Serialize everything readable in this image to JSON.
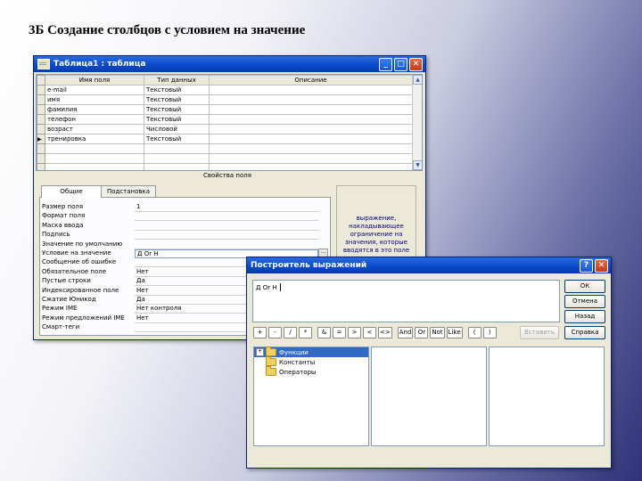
{
  "slide_title": "3Б Создание столбцов с условием на значение",
  "table_window": {
    "title": "Таблица1 : таблица",
    "columns": [
      "Имя поля",
      "Тип данных",
      "Описание"
    ],
    "rows": [
      {
        "name": "e-mail",
        "type": "Текстовый"
      },
      {
        "name": "имя",
        "type": "Текстовый"
      },
      {
        "name": "фамилия",
        "type": "Текстовый"
      },
      {
        "name": "телефон",
        "type": "Текстовый"
      },
      {
        "name": "возраст",
        "type": "Числовой"
      },
      {
        "name": "тренировка",
        "type": "Текстовый"
      }
    ],
    "props_caption": "Свойства поля",
    "tabs": [
      "Общие",
      "Подстановка"
    ],
    "properties": [
      {
        "label": "Размер поля",
        "value": "1"
      },
      {
        "label": "Формат поля",
        "value": ""
      },
      {
        "label": "Маска ввода",
        "value": ""
      },
      {
        "label": "Подпись",
        "value": ""
      },
      {
        "label": "Значение по умолчанию",
        "value": ""
      },
      {
        "label": "Условие на значение",
        "value": "Д Or Н"
      },
      {
        "label": "Сообщение об ошибке",
        "value": ""
      },
      {
        "label": "Обязательное поле",
        "value": "Нет"
      },
      {
        "label": "Пустые строки",
        "value": "Да"
      },
      {
        "label": "Индексированное поле",
        "value": "Нет"
      },
      {
        "label": "Сжатие Юникод",
        "value": "Да"
      },
      {
        "label": "Режим IME",
        "value": "Нет контроля"
      },
      {
        "label": "Режим предложений IME",
        "value": "Нет"
      },
      {
        "label": "Смарт-теги",
        "value": ""
      }
    ],
    "help_text": "выражение, накладывающее ограничение на значения, которые вводятся в это поле"
  },
  "builder_window": {
    "title": "Построитель выражений",
    "expression": "Д Or Н",
    "buttons": {
      "ok": "ОК",
      "cancel": "Отмена",
      "back": "Назад",
      "insert": "Вставить",
      "help": "Справка"
    },
    "operators": [
      "+",
      "-",
      "/",
      "*",
      "&",
      "=",
      ">",
      "<",
      "<>",
      "And",
      "Or",
      "Not",
      "Like",
      "(",
      ")"
    ],
    "tree": [
      {
        "label": "Функции",
        "expand": "+",
        "selected": true
      },
      {
        "label": "Константы",
        "expand": "",
        "selected": false
      },
      {
        "label": "Операторы",
        "expand": "",
        "selected": false
      }
    ]
  },
  "colors": {
    "titlebar": "#0848c8",
    "selection": "#316ac5",
    "help_text": "#000080"
  }
}
